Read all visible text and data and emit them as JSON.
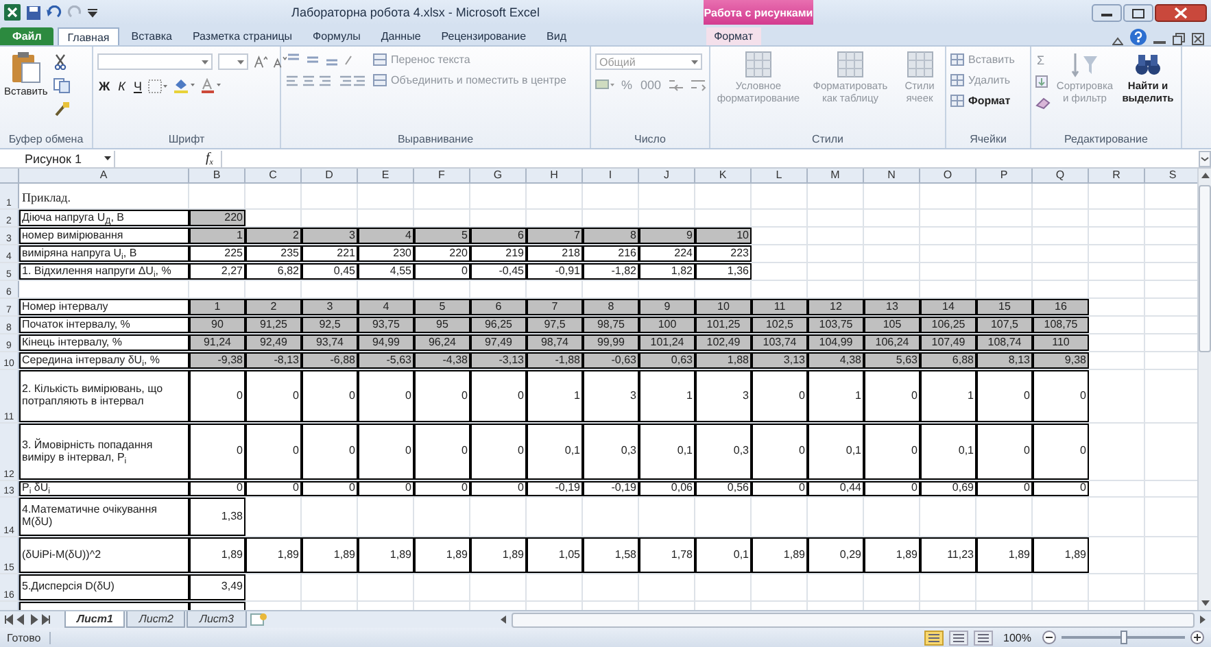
{
  "window": {
    "title": "Лабораторна робота 4.xlsx  -  Microsoft Excel",
    "context_title": "Работа с рисунками"
  },
  "ribbon_tabs": [
    {
      "label": "Файл",
      "kind": "file",
      "selected": false
    },
    {
      "label": "Главная",
      "kind": "normal",
      "selected": true
    },
    {
      "label": "Вставка",
      "kind": "normal",
      "selected": false
    },
    {
      "label": "Разметка страницы",
      "kind": "normal",
      "selected": false
    },
    {
      "label": "Формулы",
      "kind": "normal",
      "selected": false
    },
    {
      "label": "Данные",
      "kind": "normal",
      "selected": false
    },
    {
      "label": "Рецензирование",
      "kind": "normal",
      "selected": false
    },
    {
      "label": "Вид",
      "kind": "normal",
      "selected": false
    },
    {
      "label": "Формат",
      "kind": "contextual",
      "selected": false
    }
  ],
  "ribbon_groups": [
    {
      "label": "Буфер обмена",
      "kind": "clipboard",
      "buttons": [
        {
          "label": "Вставить",
          "disabled": false
        }
      ]
    },
    {
      "label": "Шрифт",
      "kind": "font",
      "buttons": [
        {
          "label": "Ж",
          "disabled": false
        },
        {
          "label": "К",
          "disabled": false
        },
        {
          "label": "Ч",
          "disabled": false
        }
      ]
    },
    {
      "label": "Выравнивание",
      "kind": "alignment",
      "buttons": [
        {
          "label": "Перенос текста",
          "disabled": true
        },
        {
          "label": "Объединить и поместить в центре",
          "disabled": true
        }
      ]
    },
    {
      "label": "Число",
      "kind": "number",
      "format": "Общий",
      "buttons": [
        {
          "label": "%",
          "disabled": true
        },
        {
          "label": "000",
          "disabled": true
        }
      ]
    },
    {
      "label": "Стили",
      "kind": "styles",
      "buttons": [
        {
          "label": "Условное форматирование",
          "disabled": true
        },
        {
          "label": "Форматировать как таблицу",
          "disabled": true
        },
        {
          "label": "Стили ячеек",
          "disabled": true
        }
      ]
    },
    {
      "label": "Ячейки",
      "kind": "cells",
      "buttons": [
        {
          "label": "Вставить",
          "disabled": true
        },
        {
          "label": "Удалить",
          "disabled": true
        },
        {
          "label": "Формат",
          "disabled": false
        }
      ]
    },
    {
      "label": "Редактирование",
      "kind": "editing",
      "buttons": [
        {
          "label": "Σ",
          "disabled": true
        },
        {
          "label": "Сортировка и фильтр",
          "disabled": true
        },
        {
          "label": "Найти и выделить",
          "disabled": false
        }
      ]
    }
  ],
  "formula_bar": {
    "name_box": "Рисунок 1",
    "function_label": "f$_{x}$"
  },
  "columns": [
    "A",
    "B",
    "C",
    "D",
    "E",
    "F",
    "G",
    "H",
    "I",
    "J",
    "K",
    "L",
    "M",
    "N",
    "O",
    "P",
    "Q",
    "R",
    "S"
  ],
  "rows": [
    {
      "number": "1",
      "kind": "title",
      "label": "Приклад.",
      "values": []
    },
    {
      "number": "2",
      "kind": "data",
      "label": "Діюча напруга U$_{Д}$, В",
      "shaded": true,
      "centered": false,
      "values": [
        "220"
      ]
    },
    {
      "number": "3",
      "kind": "data",
      "label": "номер вимірювання",
      "shaded": true,
      "centered": false,
      "values": [
        "1",
        "2",
        "3",
        "4",
        "5",
        "6",
        "7",
        "8",
        "9",
        "10"
      ]
    },
    {
      "number": "4",
      "kind": "data",
      "label": "виміряна напруга U$_{i}$, В",
      "shaded": false,
      "centered": false,
      "values": [
        "225",
        "235",
        "221",
        "230",
        "220",
        "219",
        "218",
        "216",
        "224",
        "223"
      ]
    },
    {
      "number": "5",
      "kind": "data",
      "label": "1. Відхилення напруги ΔU$_{i}$, %",
      "shaded": false,
      "centered": false,
      "values": [
        "2,27",
        "6,82",
        "0,45",
        "4,55",
        "0",
        "-0,45",
        "-0,91",
        "-1,82",
        "1,82",
        "1,36"
      ]
    },
    {
      "number": "6",
      "kind": "blank",
      "values": []
    },
    {
      "number": "7",
      "kind": "data",
      "label": "Номер інтервалу",
      "shaded": true,
      "centered": true,
      "values": [
        "1",
        "2",
        "3",
        "4",
        "5",
        "6",
        "7",
        "8",
        "9",
        "10",
        "11",
        "12",
        "13",
        "14",
        "15",
        "16"
      ]
    },
    {
      "number": "8",
      "kind": "data",
      "label": "Початок інтервалу, %",
      "shaded": true,
      "centered": true,
      "values": [
        "90",
        "91,25",
        "92,5",
        "93,75",
        "95",
        "96,25",
        "97,5",
        "98,75",
        "100",
        "101,25",
        "102,5",
        "103,75",
        "105",
        "106,25",
        "107,5",
        "108,75"
      ]
    },
    {
      "number": "9",
      "kind": "data",
      "label": "Кінець інтервалу, %",
      "shaded": true,
      "centered": true,
      "values": [
        "91,24",
        "92,49",
        "93,74",
        "94,99",
        "96,24",
        "97,49",
        "98,74",
        "99,99",
        "101,24",
        "102,49",
        "103,74",
        "104,99",
        "106,24",
        "107,49",
        "108,74",
        "110"
      ]
    },
    {
      "number": "10",
      "kind": "data",
      "label": "Середина інтервалу δU$_{i}$, %",
      "shaded": true,
      "centered": false,
      "values": [
        "-9,38",
        "-8,13",
        "-6,88",
        "-5,63",
        "-4,38",
        "-3,13",
        "-1,88",
        "-0,63",
        "0,63",
        "1,88",
        "3,13",
        "4,38",
        "5,63",
        "6,88",
        "8,13",
        "9,38"
      ]
    },
    {
      "number": "11",
      "kind": "data",
      "label": "2. Кількість вимірювань, що потрапляють в інтервал",
      "shaded": false,
      "centered": false,
      "values": [
        "0",
        "0",
        "0",
        "0",
        "0",
        "0",
        "1",
        "3",
        "1",
        "3",
        "0",
        "1",
        "0",
        "1",
        "0",
        "0"
      ]
    },
    {
      "number": "12",
      "kind": "data",
      "label": "3. Ймовірність попадання виміру в інтервал, P$_{i}$",
      "shaded": false,
      "centered": false,
      "values": [
        "0",
        "0",
        "0",
        "0",
        "0",
        "0",
        "0,1",
        "0,3",
        "0,1",
        "0,3",
        "0",
        "0,1",
        "0",
        "0,1",
        "0",
        "0"
      ]
    },
    {
      "number": "13",
      "kind": "data",
      "label": "P$_{i}$ δU$_{i}$",
      "shaded": false,
      "centered": false,
      "values": [
        "0",
        "0",
        "0",
        "0",
        "0",
        "0",
        "-0,19",
        "-0,19",
        "0,06",
        "0,56",
        "0",
        "0,44",
        "0",
        "0,69",
        "0",
        "0"
      ]
    },
    {
      "number": "14",
      "kind": "data",
      "label": "4.Математичне очікування M(δU)",
      "shaded": false,
      "centered": false,
      "values": [
        "1,38"
      ]
    },
    {
      "number": "15",
      "kind": "data",
      "label": "(δUiPi-M(δU))^2",
      "shaded": false,
      "centered": false,
      "values": [
        "1,89",
        "1,89",
        "1,89",
        "1,89",
        "1,89",
        "1,89",
        "1,05",
        "1,58",
        "1,78",
        "0,1",
        "1,89",
        "0,29",
        "1,89",
        "11,23",
        "1,89",
        "1,89"
      ]
    },
    {
      "number": "16",
      "kind": "data",
      "label": "5.Дисперсія D(δU)",
      "shaded": false,
      "centered": false,
      "values": [
        "3,49"
      ]
    }
  ],
  "sheet_tabs": [
    {
      "label": "Лист1",
      "selected": true
    },
    {
      "label": "Лист2",
      "selected": false
    },
    {
      "label": "Лист3",
      "selected": false
    }
  ],
  "status_bar": {
    "text": "Готово",
    "views": [
      {
        "selected": true
      },
      {
        "selected": false
      },
      {
        "selected": false
      }
    ],
    "zoom": "100%",
    "zoom_slider": {
      "level": 0.5
    }
  }
}
